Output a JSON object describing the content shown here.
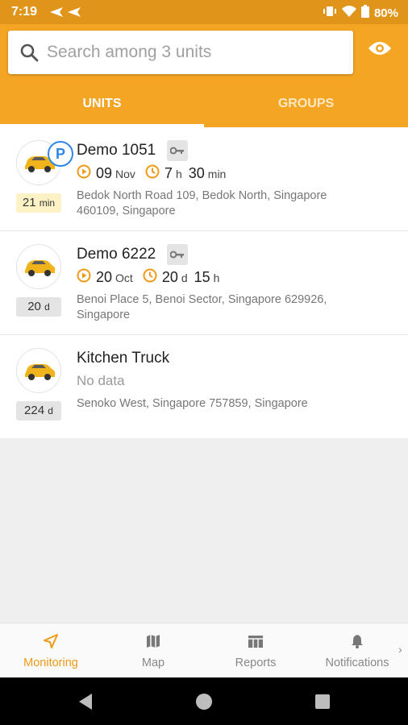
{
  "status_bar": {
    "time": "7:19",
    "battery": "80%"
  },
  "search": {
    "placeholder": "Search among 3 units"
  },
  "tabs": [
    {
      "label": "UNITS",
      "active": true
    },
    {
      "label": "GROUPS",
      "active": false
    }
  ],
  "units": [
    {
      "name": "Demo 1051",
      "age_value": "21",
      "age_unit": "min",
      "parking_badge": "P",
      "date_day": "09",
      "date_month": "Nov",
      "duration_a": "7",
      "duration_a_unit": "h",
      "duration_b": "30",
      "duration_b_unit": "min",
      "address": "Bedok North Road 109, Bedok North, Singapore 460109, Singapore"
    },
    {
      "name": "Demo 6222",
      "age_value": "20",
      "age_unit": "d",
      "date_day": "20",
      "date_month": "Oct",
      "duration_a": "20",
      "duration_a_unit": "d",
      "duration_b": "15",
      "duration_b_unit": "h",
      "address": "Benoi Place 5, Benoi Sector, Singapore 629926, Singapore"
    },
    {
      "name": "Kitchen Truck",
      "age_value": "224",
      "age_unit": "d",
      "status": "No data",
      "address": "Senoko West, Singapore 757859, Singapore"
    }
  ],
  "bottom_nav": [
    {
      "label": "Monitoring",
      "active": true
    },
    {
      "label": "Map"
    },
    {
      "label": "Reports"
    },
    {
      "label": "Notifications"
    }
  ],
  "colors": {
    "primary": "#f4a523",
    "status_bar": "#e0951a",
    "accent": "#f19a17",
    "parking": "#2f86e6"
  }
}
